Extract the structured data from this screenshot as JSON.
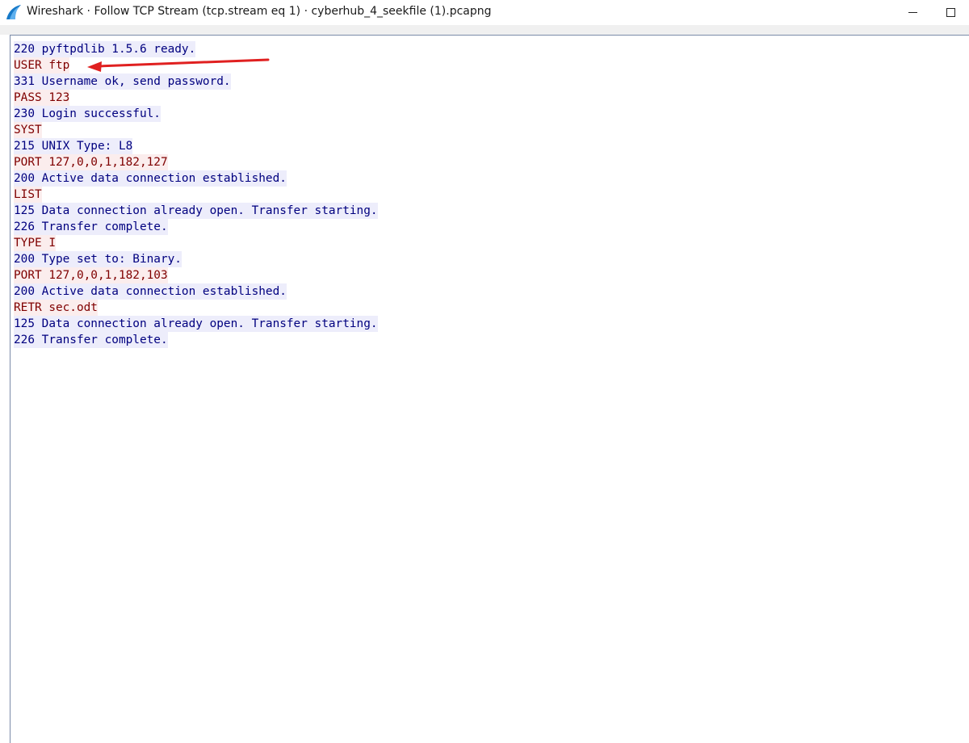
{
  "window": {
    "title": "Wireshark · Follow TCP Stream (tcp.stream eq 1) · cyberhub_4_seekfile (1).pcapng",
    "controls": [
      "minimize",
      "maximize"
    ]
  },
  "stream": {
    "colors": {
      "client_text": "#7f0000",
      "client_bg": "#fbeded",
      "server_text": "#00007f",
      "server_bg": "#ededfb"
    },
    "lines": [
      {
        "text": "220 pyftpdlib 1.5.6 ready.",
        "dir": "server"
      },
      {
        "text": "USER ftp",
        "dir": "client"
      },
      {
        "text": "331 Username ok, send password.",
        "dir": "server"
      },
      {
        "text": "PASS 123",
        "dir": "client"
      },
      {
        "text": "230 Login successful.",
        "dir": "server"
      },
      {
        "text": "SYST",
        "dir": "client"
      },
      {
        "text": "215 UNIX Type: L8",
        "dir": "server"
      },
      {
        "text": "PORT 127,0,0,1,182,127",
        "dir": "client"
      },
      {
        "text": "200 Active data connection established.",
        "dir": "server"
      },
      {
        "text": "LIST",
        "dir": "client"
      },
      {
        "text": "125 Data connection already open. Transfer starting.",
        "dir": "server"
      },
      {
        "text": "226 Transfer complete.",
        "dir": "server"
      },
      {
        "text": "TYPE I",
        "dir": "client"
      },
      {
        "text": "200 Type set to: Binary.",
        "dir": "server"
      },
      {
        "text": "PORT 127,0,0,1,182,103",
        "dir": "client"
      },
      {
        "text": "200 Active data connection established.",
        "dir": "server"
      },
      {
        "text": "RETR sec.odt",
        "dir": "client"
      },
      {
        "text": "125 Data connection already open. Transfer starting.",
        "dir": "server"
      },
      {
        "text": "226 Transfer complete.",
        "dir": "server"
      }
    ]
  },
  "annotation": {
    "type": "red-arrow",
    "color": "#e02020",
    "points_to": "USER ftp"
  }
}
